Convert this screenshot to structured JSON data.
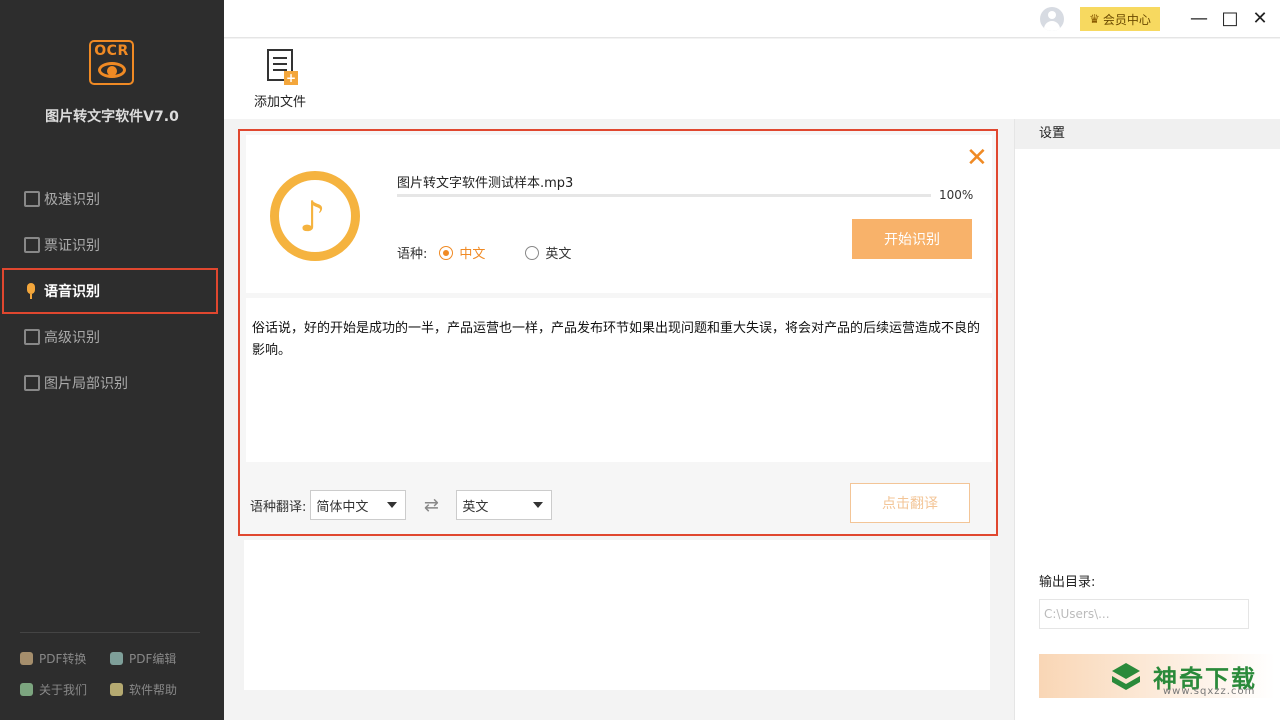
{
  "app": {
    "logo_text": "OCR",
    "title": "图片转文字软件V7.0"
  },
  "nav": {
    "items": [
      {
        "label": "极速识别"
      },
      {
        "label": "票证识别"
      },
      {
        "label": "语音识别"
      },
      {
        "label": "高级识别"
      },
      {
        "label": "图片局部识别"
      }
    ]
  },
  "footer": {
    "pdf_convert": "PDF转换",
    "pdf_edit": "PDF编辑",
    "about": "关于我们",
    "help": "软件帮助"
  },
  "titlebar": {
    "vip_label": "会员中心",
    "minimize": "—",
    "maximize": "□",
    "close": "✕"
  },
  "toolbar": {
    "add_file_label": "添加文件"
  },
  "recognize": {
    "filename": "图片转文字软件测试样本.mp3",
    "progress_percent": "100%",
    "progress_value": 100,
    "start_button": "开始识别",
    "lang_label": "语种:",
    "lang_zh": "中文",
    "lang_en": "英文",
    "result_text": "俗话说，好的开始是成功的一半，产品运营也一样，产品发布环节如果出现问题和重大失误，将会对产品的后续运营造成不良的影响。"
  },
  "translate": {
    "label": "语种翻译:",
    "source": "简体中文",
    "target": "英文",
    "button": "点击翻译"
  },
  "settings": {
    "title": "设置",
    "output_label": "输出目录:",
    "output_path": "C:\\Users\\..."
  },
  "watermark": {
    "brand": "神奇下载",
    "url": "www.sqxzz.com"
  },
  "colors": {
    "accent": "#f08a24",
    "highlight_border": "#e0472f",
    "sidebar_bg": "#2d2d2d"
  }
}
